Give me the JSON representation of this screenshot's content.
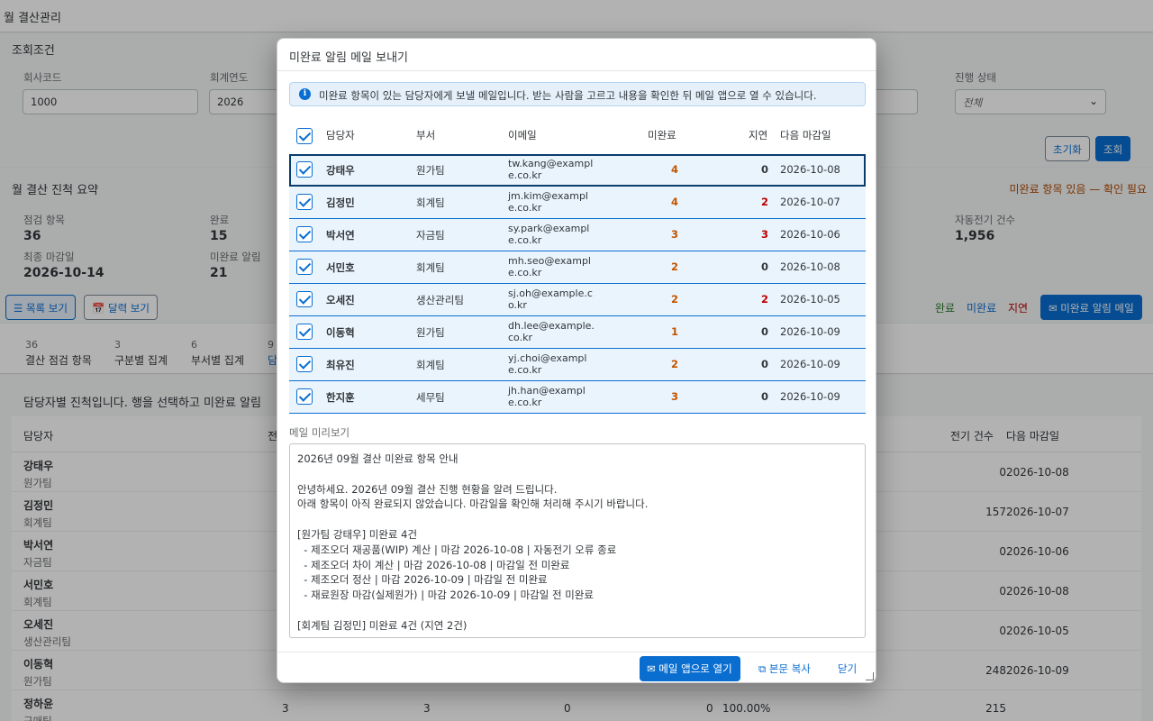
{
  "page": {
    "title": "월 결산관리"
  },
  "filters": {
    "title": "조회조건",
    "company_code": {
      "label": "회사코드",
      "value": "1000"
    },
    "fiscal_year": {
      "label": "회계연도",
      "value": "2026"
    },
    "status": {
      "label": "진행 상태",
      "value": "전체"
    },
    "reset_label": "초기화",
    "search_label": "조회"
  },
  "summary": {
    "title": "월 결산 진척 요약",
    "warning": "미완료 항목 있음 — 확인 필요",
    "check_items": {
      "label": "점검 항목",
      "value": "36"
    },
    "completed": {
      "label": "완료",
      "value": "15"
    },
    "final_due": {
      "label": "최종 마감일",
      "value": "2026-10-14"
    },
    "incomplete_alerts": {
      "label": "미완료 알림",
      "value": "21"
    },
    "auto_posting": {
      "label": "자동전기 건수",
      "value": "1,956"
    },
    "list_view_label": "목록 보기",
    "calendar_view_label": "달력 보기",
    "legend_done": "완료",
    "legend_incomplete": "미완료",
    "legend_delayed": "지연",
    "mail_button_label": "미완료 알림 메일",
    "colors": {
      "done": "#2b7d2b",
      "incomplete": "#0a6ed1",
      "delayed": "#bb0000"
    }
  },
  "tabs": [
    {
      "count": "36",
      "label": "결산 점검 항목"
    },
    {
      "count": "3",
      "label": "구분별 집계"
    },
    {
      "count": "6",
      "label": "부서별 집계"
    },
    {
      "count": "9",
      "label": "담"
    }
  ],
  "content": {
    "note": "담당자별 진척입니다. 행을 선택하고 미완료 알림 ",
    "headers": {
      "owner": "담당자",
      "total": "전",
      "postings": "전기 건수",
      "next_due": "다음 마감일"
    },
    "rows": [
      {
        "name": "강태우",
        "dept": "원가팀",
        "postings": "0",
        "due": "2026-10-08"
      },
      {
        "name": "김정민",
        "dept": "회계팀",
        "postings": "157",
        "due": "2026-10-07"
      },
      {
        "name": "박서연",
        "dept": "자금팀",
        "postings": "0",
        "due": "2026-10-06"
      },
      {
        "name": "서민호",
        "dept": "회계팀",
        "postings": "0",
        "due": "2026-10-08"
      },
      {
        "name": "오세진",
        "dept": "생산관리팀",
        "postings": "0",
        "due": "2026-10-05"
      },
      {
        "name": "이동혁",
        "dept": "원가팀",
        "postings": "248",
        "due": "2026-10-09"
      },
      {
        "name": "정하윤",
        "dept": "구매팀",
        "postings": "215",
        "due": "",
        "total": "3",
        "done": "3",
        "delayed": "0",
        "rate": "100.00%"
      }
    ]
  },
  "dialog": {
    "title": "미완료 알림 메일 보내기",
    "info": "미완료 항목이 있는 담당자에게 보낼 메일입니다. 받는 사람을 고르고 내용을 확인한 뒤 메일 앱으로 열 수 있습니다.",
    "headers": {
      "owner": "담당자",
      "dept": "부서",
      "email": "이메일",
      "incomplete": "미완료",
      "delayed": "지연",
      "next_due": "다음 마감일"
    },
    "recipients": [
      {
        "name": "강태우",
        "dept": "원가팀",
        "email": "tw.kang@example.co.kr",
        "incomplete": "4",
        "delayed": "0",
        "due": "2026-10-08"
      },
      {
        "name": "김정민",
        "dept": "회계팀",
        "email": "jm.kim@example.co.kr",
        "incomplete": "4",
        "delayed": "2",
        "due": "2026-10-07"
      },
      {
        "name": "박서연",
        "dept": "자금팀",
        "email": "sy.park@example.co.kr",
        "incomplete": "3",
        "delayed": "3",
        "due": "2026-10-06"
      },
      {
        "name": "서민호",
        "dept": "회계팀",
        "email": "mh.seo@example.co.kr",
        "incomplete": "2",
        "delayed": "0",
        "due": "2026-10-08"
      },
      {
        "name": "오세진",
        "dept": "생산관리팀",
        "email": "sj.oh@example.co.kr",
        "incomplete": "2",
        "delayed": "2",
        "due": "2026-10-05"
      },
      {
        "name": "이동혁",
        "dept": "원가팀",
        "email": "dh.lee@example.co.kr",
        "incomplete": "1",
        "delayed": "0",
        "due": "2026-10-09"
      },
      {
        "name": "최유진",
        "dept": "회계팀",
        "email": "yj.choi@example.co.kr",
        "incomplete": "2",
        "delayed": "0",
        "due": "2026-10-09"
      },
      {
        "name": "한지훈",
        "dept": "세무팀",
        "email": "jh.han@example.co.kr",
        "incomplete": "3",
        "delayed": "0",
        "due": "2026-10-09"
      }
    ],
    "preview_label": "메일 미리보기",
    "preview_text": "2026년 09월 결산 미완료 항목 안내\n\n안녕하세요. 2026년 09월 결산 진행 현황을 알려 드립니다.\n아래 항목이 아직 완료되지 않았습니다. 마감일을 확인해 처리해 주시기 바랍니다.\n\n[원가팀 강태우] 미완료 4건\n  - 제조오더 재공품(WIP) 계산 | 마감 2026-10-08 | 자동전기 오류 종료\n  - 제조오더 차이 계산 | 마감 2026-10-08 | 마감일 전 미완료\n  - 제조오더 정산 | 마감 2026-10-09 | 마감일 전 미완료\n  - 재료원장 마감(실제원가) | 마감 2026-10-09 | 마감일 전 미완료\n\n[회계팀 김정민] 미완료 4건 (지연 2건)",
    "open_mail_label": "메일 앱으로 열기",
    "copy_label": "본문 복사",
    "close_label": "닫기",
    "colors": {
      "incomplete": "#c35500",
      "delayed": "#bb0000",
      "zero": "#32363a"
    }
  }
}
